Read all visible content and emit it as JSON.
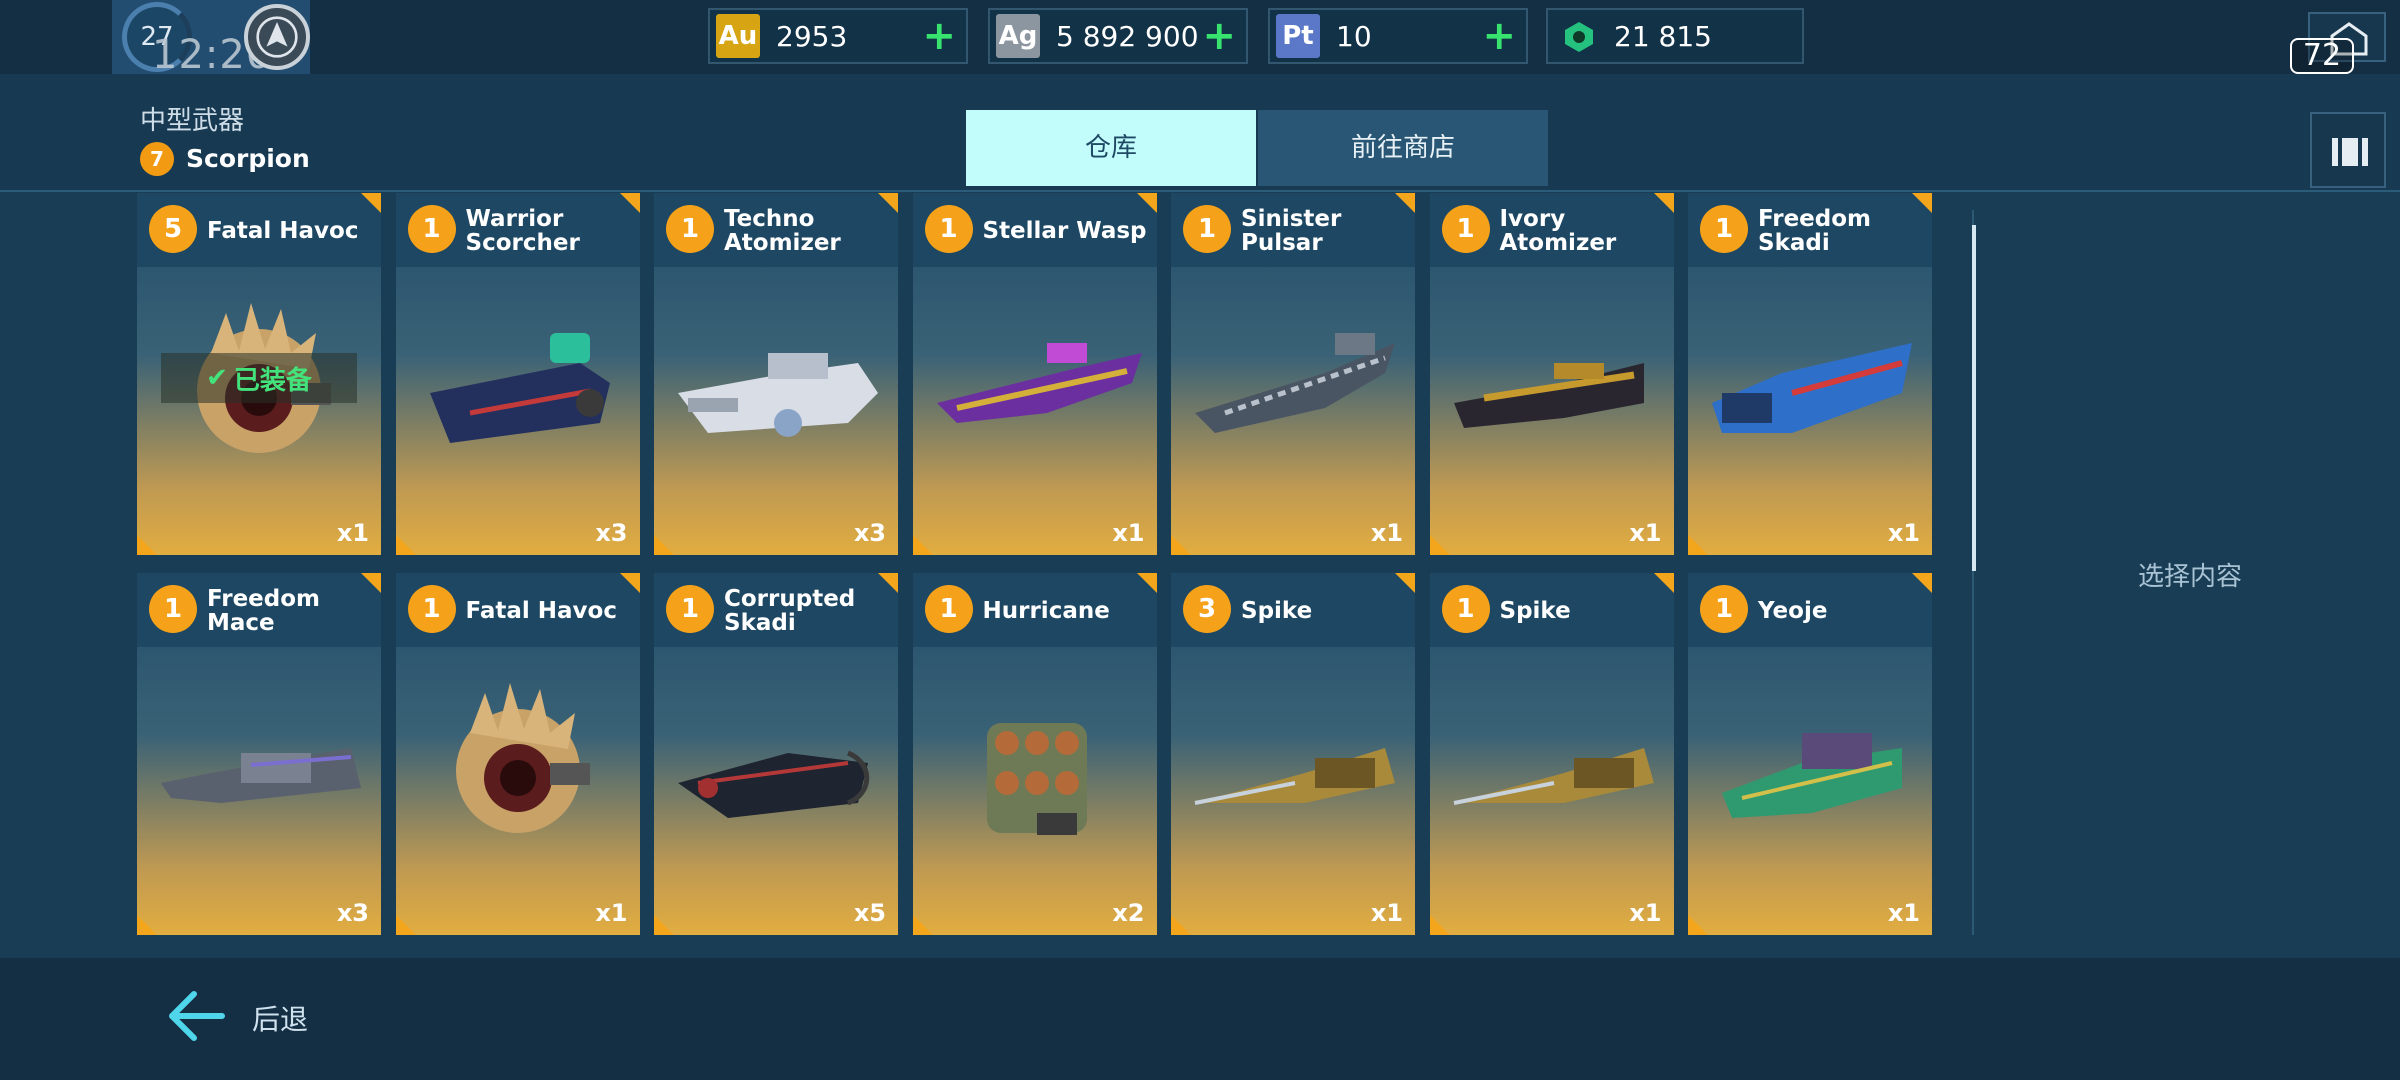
{
  "player": {
    "level": "27",
    "clock": "12:20"
  },
  "currencies": [
    {
      "code": "Au",
      "value": "2953",
      "color": "#d7a514"
    },
    {
      "code": "Ag",
      "value": "5 892 900",
      "color": "#8c96a0"
    },
    {
      "code": "Pt",
      "value": "10",
      "color": "#5a77c8"
    },
    {
      "code": "gem",
      "value": "21 815",
      "color": "#25c27f"
    }
  ],
  "fps": "72",
  "header": {
    "weapon_type": "中型武器",
    "slot_level": "7",
    "slot_name": "Scorpion"
  },
  "tabs": {
    "warehouse": "仓库",
    "shop": "前往商店"
  },
  "equipped_label": "已装备",
  "items": [
    {
      "level": "5",
      "name": "Fatal Havoc",
      "qty": "x1",
      "art": "claw",
      "equipped": true
    },
    {
      "level": "1",
      "name": "Warrior Scorcher",
      "qty": "x3",
      "art": "blue-cannon"
    },
    {
      "level": "1",
      "name": "Techno Atomizer",
      "qty": "x3",
      "art": "white-gun"
    },
    {
      "level": "1",
      "name": "Stellar Wasp",
      "qty": "x1",
      "art": "purple-gun"
    },
    {
      "level": "1",
      "name": "Sinister Pulsar",
      "qty": "x1",
      "art": "grey-gun"
    },
    {
      "level": "1",
      "name": "Ivory Atomizer",
      "qty": "x1",
      "art": "black-gold-gun"
    },
    {
      "level": "1",
      "name": "Freedom Skadi",
      "qty": "x1",
      "art": "blue-red-gun"
    },
    {
      "level": "1",
      "name": "Freedom Mace",
      "qty": "x3",
      "art": "grey-cannon"
    },
    {
      "level": "1",
      "name": "Fatal Havoc",
      "qty": "x1",
      "art": "claw"
    },
    {
      "level": "1",
      "name": "Corrupted Skadi",
      "qty": "x5",
      "art": "dark-gun"
    },
    {
      "level": "1",
      "name": "Hurricane",
      "qty": "x2",
      "art": "rocket-pod"
    },
    {
      "level": "3",
      "name": "Spike",
      "qty": "x1",
      "art": "spike"
    },
    {
      "level": "1",
      "name": "Spike",
      "qty": "x1",
      "art": "spike"
    },
    {
      "level": "1",
      "name": "Yeoje",
      "qty": "x1",
      "art": "green-gun"
    }
  ],
  "side_panel": {
    "label": "选择内容"
  },
  "footer": {
    "back_label": "后退"
  }
}
